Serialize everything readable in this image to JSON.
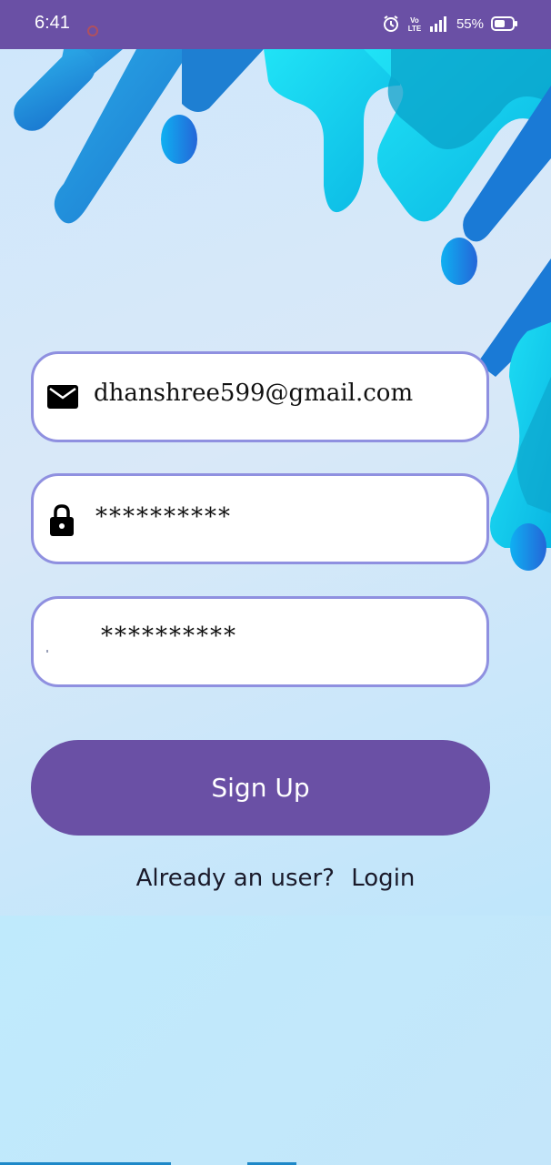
{
  "status_bar": {
    "time": "6:41",
    "battery_percent": "55%",
    "volte_label": "Vo LTE",
    "icons": [
      "notification-icon",
      "alarm-icon",
      "volte-icon",
      "signal-icon",
      "battery-icon"
    ]
  },
  "form": {
    "email_value": "dhanshree599@gmail.com",
    "password_value": "**********",
    "confirm_password_value": "**********"
  },
  "signup_button": {
    "label": "Sign Up"
  },
  "login_prompt": {
    "text": "Already an user?",
    "link_label": "Login"
  },
  "colors": {
    "primary": "#6a50a5",
    "field_border": "#8f90e0",
    "background": "#c2e9fb",
    "blob_blue": "#1e88d8",
    "blob_cyan": "#18c7ea"
  }
}
